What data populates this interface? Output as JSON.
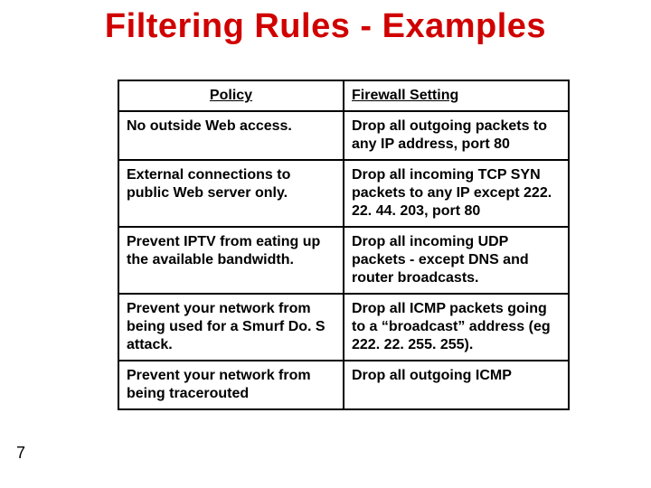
{
  "title": "Filtering Rules - Examples",
  "page_number": "7",
  "table": {
    "headers": {
      "policy": "Policy",
      "setting": "Firewall Setting"
    },
    "rows": [
      {
        "policy": "No outside Web access.",
        "setting": "Drop all outgoing packets to any IP address, port 80"
      },
      {
        "policy": "External connections to public Web server only.",
        "setting": "Drop all incoming TCP SYN packets to any IP except 222. 22. 44. 203, port 80"
      },
      {
        "policy": "Prevent IPTV from eating up the available bandwidth.",
        "setting": "Drop all incoming UDP packets - except DNS and router broadcasts."
      },
      {
        "policy": "Prevent your network from being used for a Smurf Do. S attack.",
        "setting": "Drop all ICMP packets going to a “broadcast” address (eg 222. 22. 255. 255)."
      },
      {
        "policy": "Prevent your network from being tracerouted",
        "setting": "Drop all outgoing ICMP"
      }
    ]
  }
}
